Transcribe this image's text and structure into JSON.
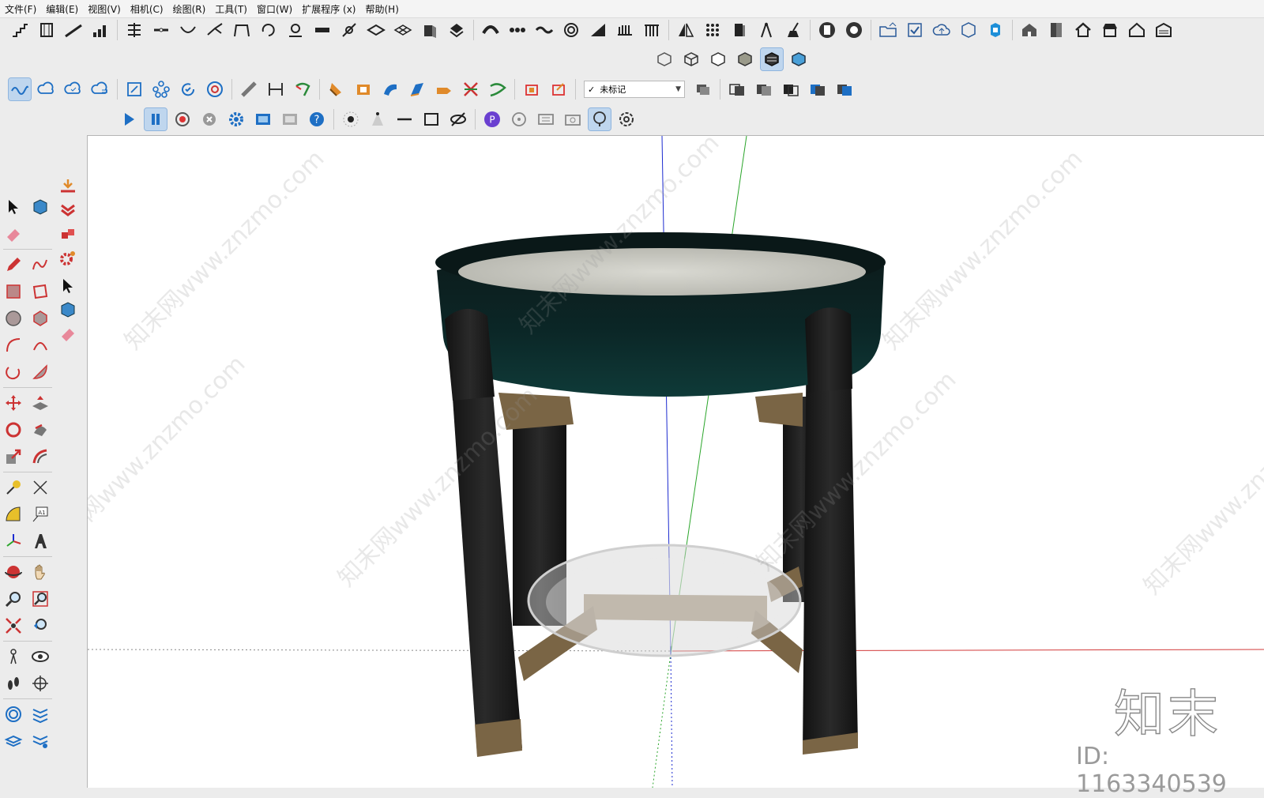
{
  "menu": [
    "文件(F)",
    "编辑(E)",
    "视图(V)",
    "相机(C)",
    "绘图(R)",
    "工具(T)",
    "窗口(W)",
    "扩展程序 (x)",
    "帮助(H)"
  ],
  "tag_dropdown": {
    "check": "✓",
    "value": "未标记"
  },
  "watermark": {
    "logo": "知末",
    "id_text": "ID: 1163340539",
    "repeat_text": "知末网www.znzmo.com"
  },
  "colors": {
    "accent": "#1e6fc4",
    "axis_blue": "#1c2bd0",
    "axis_green": "#2aa52a",
    "axis_red": "#d23a3a",
    "table_top": "#0b1f1f",
    "legs": "#1b1b1b",
    "brass": "#7a6545"
  }
}
